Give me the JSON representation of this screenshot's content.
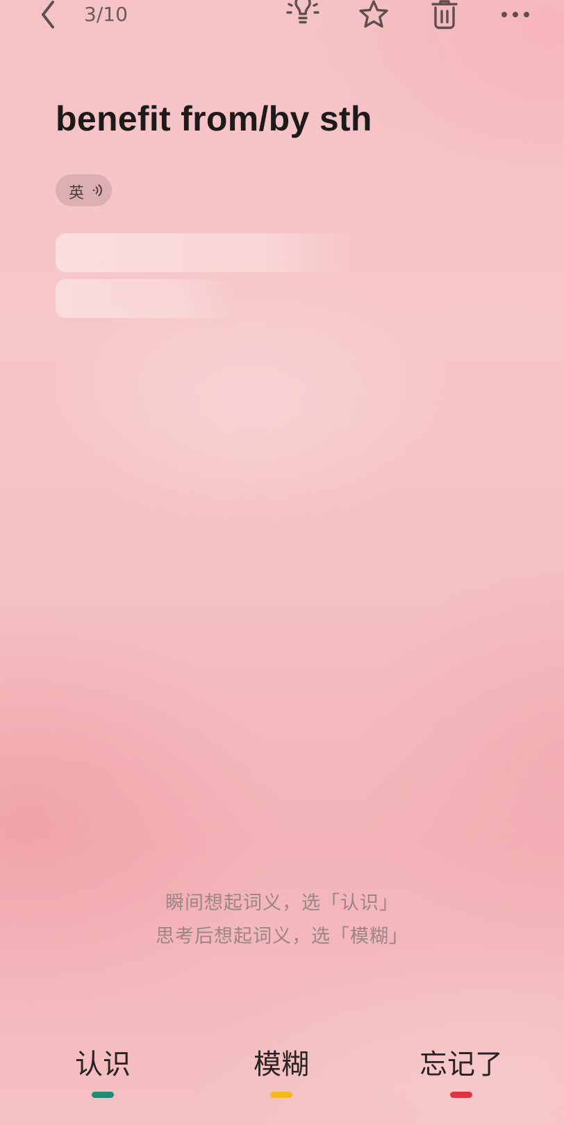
{
  "header": {
    "counter": "3/10",
    "icons": {
      "back": "chevron-left-icon",
      "hint": "lightbulb-icon",
      "favorite": "star-icon",
      "delete": "trash-icon",
      "more": "more-dots-icon"
    }
  },
  "card": {
    "word": "benefit from/by sth",
    "pronunciation_label": "英",
    "meaning_hidden": true
  },
  "hint": {
    "line1": "瞬间想起词义，选「认识」",
    "line2": "思考后想起词义，选「模糊」"
  },
  "actions": [
    {
      "label": "认识",
      "color": "#1e8a78"
    },
    {
      "label": "模糊",
      "color": "#f5b820"
    },
    {
      "label": "忘记了",
      "color": "#e0333f"
    }
  ]
}
